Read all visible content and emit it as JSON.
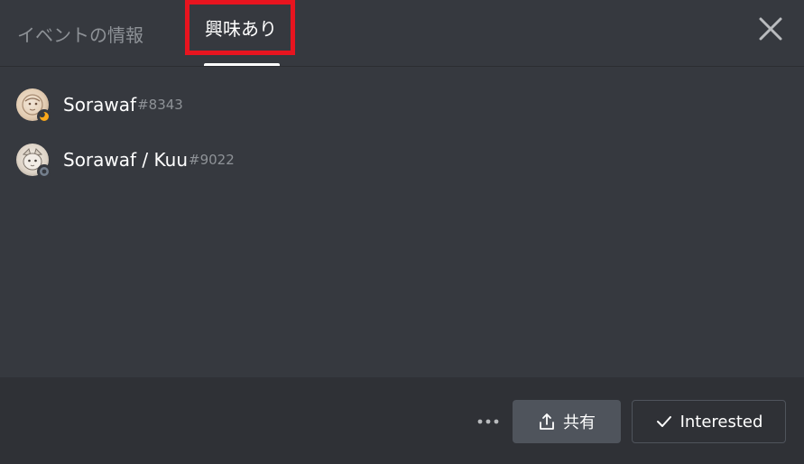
{
  "tabs": {
    "info_label": "イベントの情報",
    "interested_label": "興味あり"
  },
  "users": [
    {
      "name": "Sorawaf",
      "discriminator": "#8343",
      "status": "idle"
    },
    {
      "name": "Sorawaf / Kuu",
      "discriminator": "#9022",
      "status": "offline"
    }
  ],
  "footer": {
    "more_icon": "ellipsis-icon",
    "share_label": "共有",
    "share_icon": "share-icon",
    "interested_label": "Interested",
    "interested_icon": "checkmark-icon"
  },
  "colors": {
    "background": "#36393f",
    "footer_background": "#2f3136",
    "highlight_border": "#e8141f",
    "idle_status": "#faa81a",
    "offline_status": "#747f8d"
  }
}
